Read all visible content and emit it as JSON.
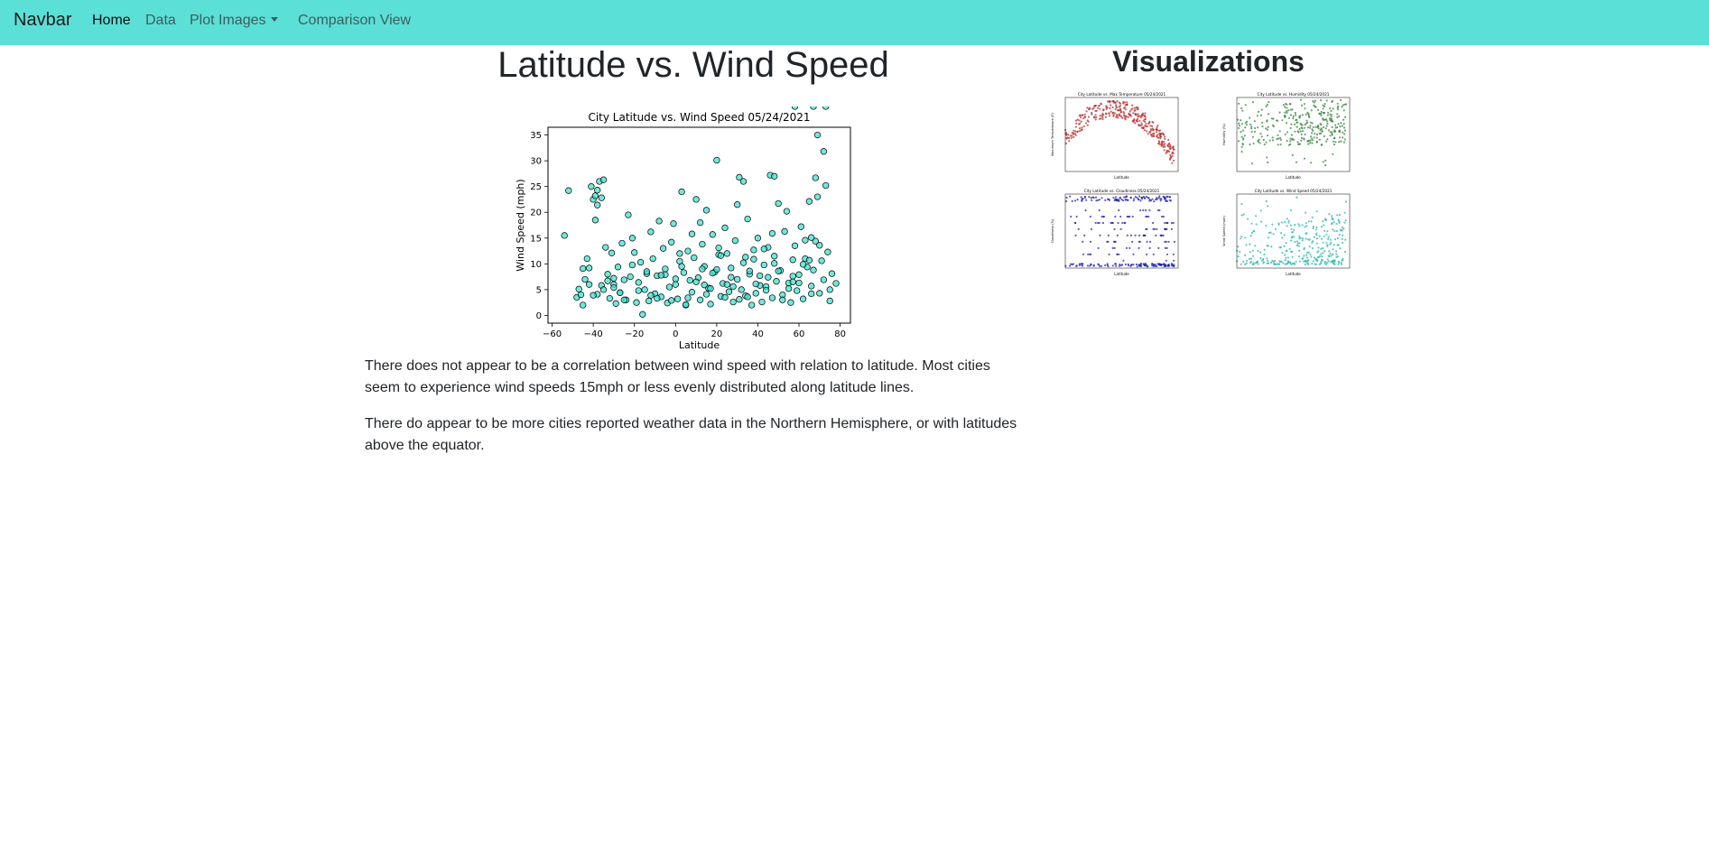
{
  "navbar": {
    "brand": "Navbar",
    "links": [
      "Home",
      "Data",
      "Plot Images",
      "Comparison View"
    ]
  },
  "main": {
    "title": "Latitude vs. Wind Speed",
    "paragraphs": [
      "There does not appear to be a correlation between wind speed with relation to latitude. Most cities seem to experience wind speeds 15mph or less evenly distributed along latitude lines.",
      "There do appear to be more cities reported weather data in the Northern Hemisphere, or with latitudes above the equator."
    ]
  },
  "sidebar": {
    "title": "Visualizations"
  },
  "colors": {
    "navbar": "#5ae0d7",
    "wind_points": "#40e0d0",
    "temp_points": "#b22222",
    "humidity_points": "#2e7d32",
    "cloud_points": "#1a1aa6",
    "thumb_wind_points": "#20b2aa"
  },
  "chart_data": [
    {
      "type": "scatter",
      "title": "City Latitude vs. Wind Speed 05/24/2021",
      "xlabel": "Latitude",
      "ylabel": "Wind Speed (mph)",
      "xlim": [
        -62,
        85
      ],
      "ylim": [
        -1.5,
        36.5
      ],
      "xticks": [
        "−60",
        "−40",
        "−20",
        "0",
        "20",
        "40",
        "60",
        "80"
      ],
      "yticks": [
        "0",
        "5",
        "10",
        "15",
        "20",
        "25",
        "30",
        "35"
      ],
      "x": [
        -54,
        -52,
        -48,
        -47,
        -45,
        -44,
        -43,
        -42,
        -41,
        -40,
        -39,
        -38,
        -37,
        -36,
        -35,
        -34,
        -33,
        -32,
        -31,
        -30,
        -29,
        -28,
        -27,
        -26,
        -25,
        -24,
        -23,
        -22,
        -21,
        -20,
        -19,
        -18,
        -17,
        -16,
        -15,
        -14,
        -13,
        -12,
        -11,
        -10,
        -9,
        -8,
        -7,
        -6,
        -5,
        -4,
        -3,
        -2,
        -1,
        0,
        1,
        2,
        3,
        4,
        5,
        6,
        7,
        8,
        9,
        10,
        11,
        12,
        13,
        14,
        15,
        16,
        17,
        18,
        19,
        20,
        21,
        22,
        23,
        24,
        25,
        26,
        27,
        28,
        29,
        30,
        31,
        32,
        33,
        34,
        35,
        36,
        37,
        38,
        39,
        40,
        41,
        42,
        43,
        44,
        45,
        46,
        47,
        48,
        49,
        50,
        51,
        52,
        53,
        54,
        55,
        56,
        57,
        58,
        59,
        60,
        61,
        62,
        63,
        64,
        65,
        66,
        67,
        68,
        69,
        70,
        71,
        72,
        73,
        74,
        75,
        76,
        78,
        -46,
        -42,
        -38,
        -35,
        -30,
        -25,
        -21,
        -18,
        -14,
        -9,
        -5,
        -2,
        2,
        6,
        10,
        13,
        17,
        22,
        27,
        31,
        36,
        41,
        44,
        48,
        52,
        57,
        62,
        66,
        69,
        72,
        66,
        68,
        48,
        21,
        30,
        33,
        -39,
        -38,
        -36,
        8,
        12,
        43,
        57,
        63,
        20,
        -40,
        -30,
        5,
        15,
        25,
        35,
        45,
        55,
        65,
        75,
        -45,
        -33,
        -27,
        -12,
        0,
        18,
        28,
        38,
        50,
        60,
        70,
        -7,
        3,
        14,
        24,
        34,
        39,
        47,
        58,
        67,
        73
      ],
      "y": [
        15.5,
        24.2,
        3.5,
        5.1,
        2.0,
        7.0,
        11.0,
        9.2,
        25.0,
        22.5,
        18.5,
        4.1,
        26.0,
        5.8,
        26.3,
        13.2,
        8.0,
        3.3,
        12.1,
        6.0,
        2.3,
        9.4,
        4.4,
        14.0,
        6.9,
        3.0,
        19.5,
        7.5,
        15.0,
        12.2,
        2.5,
        6.4,
        10.3,
        0.2,
        5.0,
        8.1,
        2.8,
        16.2,
        11.0,
        4.2,
        7.7,
        18.3,
        3.6,
        13.0,
        9.0,
        2.4,
        5.5,
        14.2,
        17.8,
        6.0,
        3.2,
        10.5,
        24.0,
        8.3,
        2.0,
        12.5,
        6.8,
        4.5,
        11.2,
        22.5,
        7.3,
        3.0,
        13.8,
        9.5,
        20.4,
        5.3,
        2.2,
        15.7,
        8.4,
        30.1,
        11.8,
        3.7,
        6.2,
        17.0,
        12.0,
        4.6,
        9.2,
        2.6,
        14.5,
        7.0,
        26.8,
        5.0,
        10.2,
        3.8,
        18.7,
        8.0,
        2.0,
        12.7,
        4.3,
        15.0,
        7.7,
        2.6,
        9.8,
        5.6,
        13.2,
        27.2,
        3.4,
        11.5,
        6.6,
        21.7,
        8.7,
        4.0,
        16.3,
        20.2,
        6.3,
        2.5,
        10.8,
        13.5,
        4.8,
        7.9,
        17.2,
        3.2,
        11.0,
        9.4,
        22.1,
        5.7,
        8.8,
        14.4,
        23.0,
        4.3,
        10.6,
        6.9,
        25.2,
        12.3,
        5.0,
        8.1,
        6.2,
        4.0,
        6.0,
        21.4,
        5.0,
        7.2,
        3.0,
        9.8,
        4.8,
        8.5,
        3.3,
        7.9,
        2.9,
        12.0,
        3.4,
        6.5,
        9.0,
        5.2,
        11.6,
        7.4,
        3.1,
        8.6,
        5.8,
        4.9,
        10.1,
        3.0,
        7.6,
        9.9,
        4.2,
        35.0,
        31.8,
        15.1,
        26.7,
        27.0,
        13.1,
        21.5,
        26.0,
        23.2,
        24.3,
        22.8,
        15.8,
        18.0,
        12.9,
        6.5,
        14.6,
        8.9,
        3.9,
        5.4,
        2.1,
        4.1,
        6.0,
        3.6,
        7.4,
        5.2,
        10.7,
        2.8,
        9.1,
        6.7,
        4.4,
        3.9,
        7.1,
        8.2,
        5.6,
        10.9,
        8.6,
        6.3,
        13.6,
        7.8,
        9.5,
        5.9,
        3.5,
        11.3,
        6.1,
        15.9
      ]
    },
    {
      "type": "scatter",
      "title": "City Latitude vs. Max Temperature 05/24/2021",
      "xlabel": "Latitude",
      "ylabel": "Maximum Temperature (F)"
    },
    {
      "type": "scatter",
      "title": "City Latitude vs. Humidity 05/24/2021",
      "xlabel": "Latitude",
      "ylabel": "Humidity (%)"
    },
    {
      "type": "scatter",
      "title": "City Latitude vs. Cloudiness 05/24/2021",
      "xlabel": "Latitude",
      "ylabel": "Cloudiness (%)"
    },
    {
      "type": "scatter",
      "title": "City Latitude vs. Wind Speed 05/24/2021",
      "xlabel": "Latitude",
      "ylabel": "Wind Speed (mph)"
    }
  ]
}
